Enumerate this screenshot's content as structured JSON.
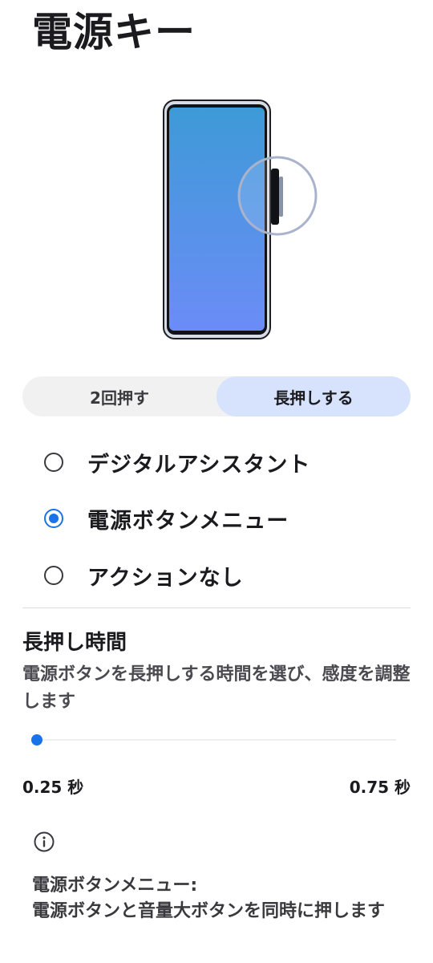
{
  "header": {
    "title": "電源キー"
  },
  "illustration": {
    "screen_gradient": [
      "#3e9ad7",
      "#6b8cf7"
    ],
    "highlight_ring_color": "#a9b4cc"
  },
  "tabs": [
    {
      "label": "2回押す",
      "active": false
    },
    {
      "label": "長押しする",
      "active": true
    }
  ],
  "options": [
    {
      "label": "デジタルアシスタント",
      "checked": false
    },
    {
      "label": "電源ボタンメニュー",
      "checked": true
    },
    {
      "label": "アクションなし",
      "checked": false
    }
  ],
  "press_duration": {
    "title": "長押し時間",
    "description": "電源ボタンを長押しする時間を選び、感度を調整します",
    "slider_value": 0.0,
    "min_label": "0.25 秒",
    "max_label": "0.75 秒"
  },
  "info": {
    "icon": "info-icon",
    "heading": "電源ボタンメニュー:",
    "body": "電源ボタンと音量大ボタンを同時に押します"
  },
  "colors": {
    "accent": "#1a73e8",
    "selected_tab_bg": "#d7e3fc",
    "tab_bg": "#f1f1f2"
  }
}
